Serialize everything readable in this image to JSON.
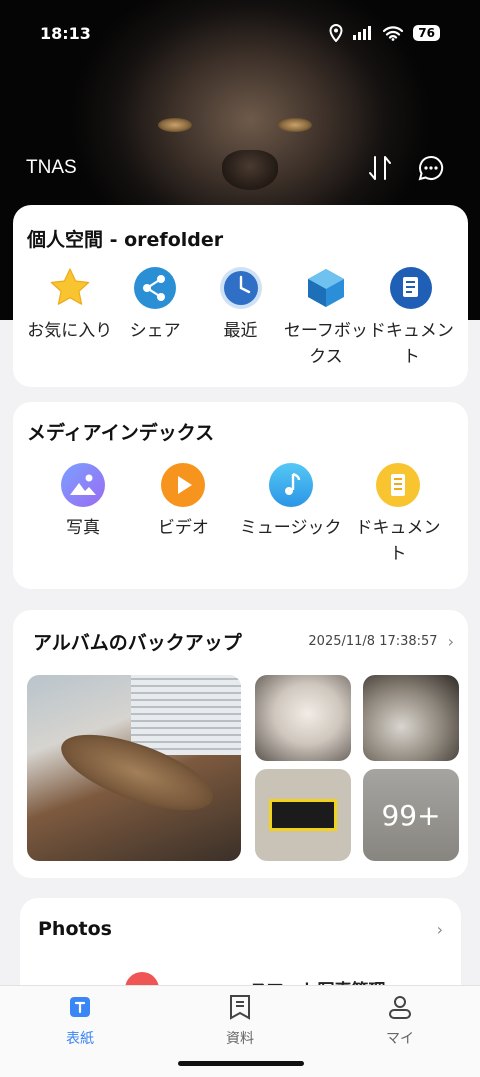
{
  "status_bar": {
    "time": "18:13",
    "battery": "76"
  },
  "hero": {
    "title": "TNAS"
  },
  "personal_space": {
    "title": "個人空間 - orefolder",
    "items": [
      {
        "label": "お気に入り",
        "icon": "star-icon"
      },
      {
        "label": "シェア",
        "icon": "share-icon"
      },
      {
        "label": "最近",
        "icon": "clock-icon"
      },
      {
        "label": "セーフボックス",
        "icon": "cube-icon"
      },
      {
        "label": "ドキュメント",
        "icon": "document-icon"
      }
    ]
  },
  "media_index": {
    "title": "メディアインデックス",
    "items": [
      {
        "label": "写真",
        "icon": "photo-icon"
      },
      {
        "label": "ビデオ",
        "icon": "play-icon"
      },
      {
        "label": "ミュージック",
        "icon": "music-icon"
      },
      {
        "label": "ドキュメント",
        "icon": "document-icon"
      }
    ]
  },
  "album_backup": {
    "title": "アルバムのバックアップ",
    "timestamp": "2025/11/8 17:38:57",
    "more_count": "99+"
  },
  "photos_card": {
    "title": "Photos",
    "peek_label": "スマート写真管理"
  },
  "bottom_nav": [
    {
      "label": "表紙",
      "active": true
    },
    {
      "label": "資料",
      "active": false
    },
    {
      "label": "マイ",
      "active": false
    }
  ],
  "colors": {
    "accent": "#3a86f6",
    "background": "#f2f2f4"
  }
}
